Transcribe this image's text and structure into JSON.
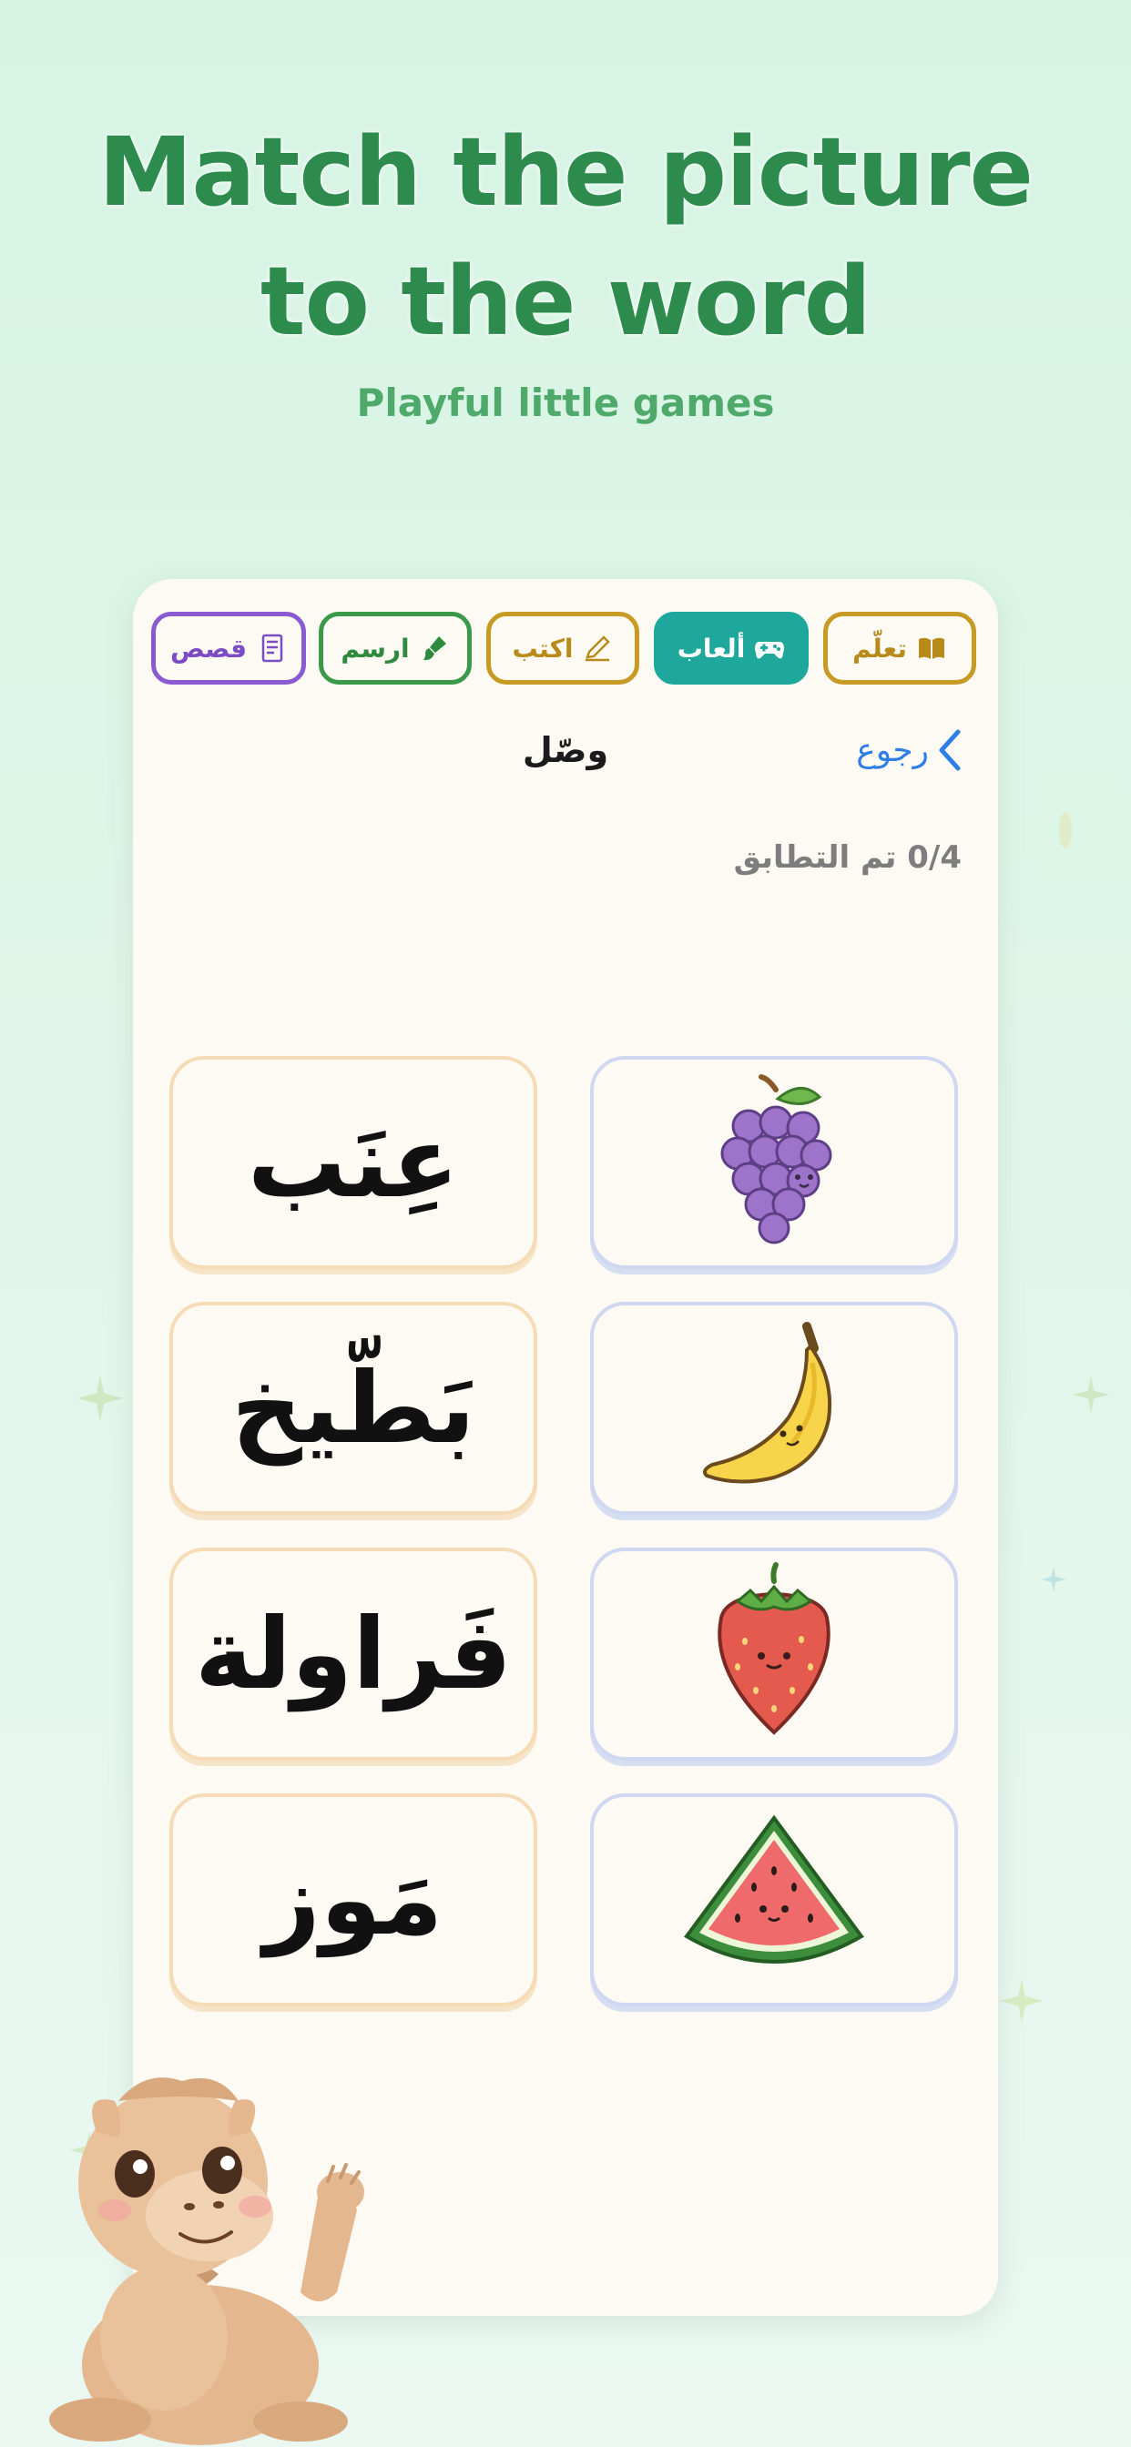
{
  "promo": {
    "headline_line1": "Match the picture",
    "headline_line2": "to the word",
    "subhead": "Playful little games"
  },
  "tabs": [
    {
      "label": "تعلّم",
      "icon": "book-icon",
      "active": false
    },
    {
      "label": "ألعاب",
      "icon": "gamepad-icon",
      "active": true
    },
    {
      "label": "اكتب",
      "icon": "pencil-icon",
      "active": false
    },
    {
      "label": "ارسم",
      "icon": "paintbrush-icon",
      "active": false
    },
    {
      "label": "قصص",
      "icon": "storybook-icon",
      "active": false
    }
  ],
  "header": {
    "back_label": "رجوع",
    "title": "وصّل"
  },
  "progress_text": "0/4 تم التطابق",
  "words": [
    "عِنَب",
    "بَطّيخ",
    "فَراولة",
    "مَوز"
  ],
  "pictures": [
    "grapes-image",
    "banana-image",
    "strawberry-image",
    "watermelon-image"
  ],
  "colors": {
    "headline": "#2c8b4d",
    "active_tab": "#1ea89c",
    "back_link": "#2f7ee6"
  }
}
